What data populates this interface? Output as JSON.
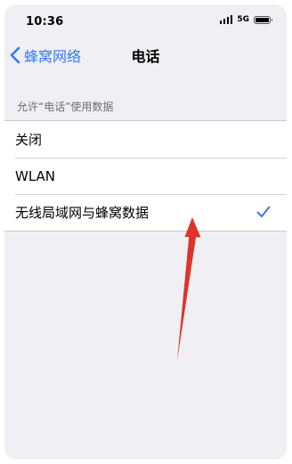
{
  "status_bar": {
    "time": "10:36",
    "network": "5G",
    "icons": [
      "signal-icon",
      "battery-icon"
    ]
  },
  "nav": {
    "back_label": "蜂窝网络",
    "back_icon": "chevron-left-icon",
    "title": "电话"
  },
  "section": {
    "header": "允许“电话”使用数据",
    "options": [
      {
        "label": "关闭",
        "selected": false
      },
      {
        "label": "WLAN",
        "selected": false
      },
      {
        "label": "无线局域网与蜂窝数据",
        "selected": true
      }
    ]
  },
  "colors": {
    "accent": "#3478f6",
    "background": "#efeff4",
    "annotation": "#e0322c"
  },
  "annotation": {
    "icon": "red-arrow-annotation"
  }
}
